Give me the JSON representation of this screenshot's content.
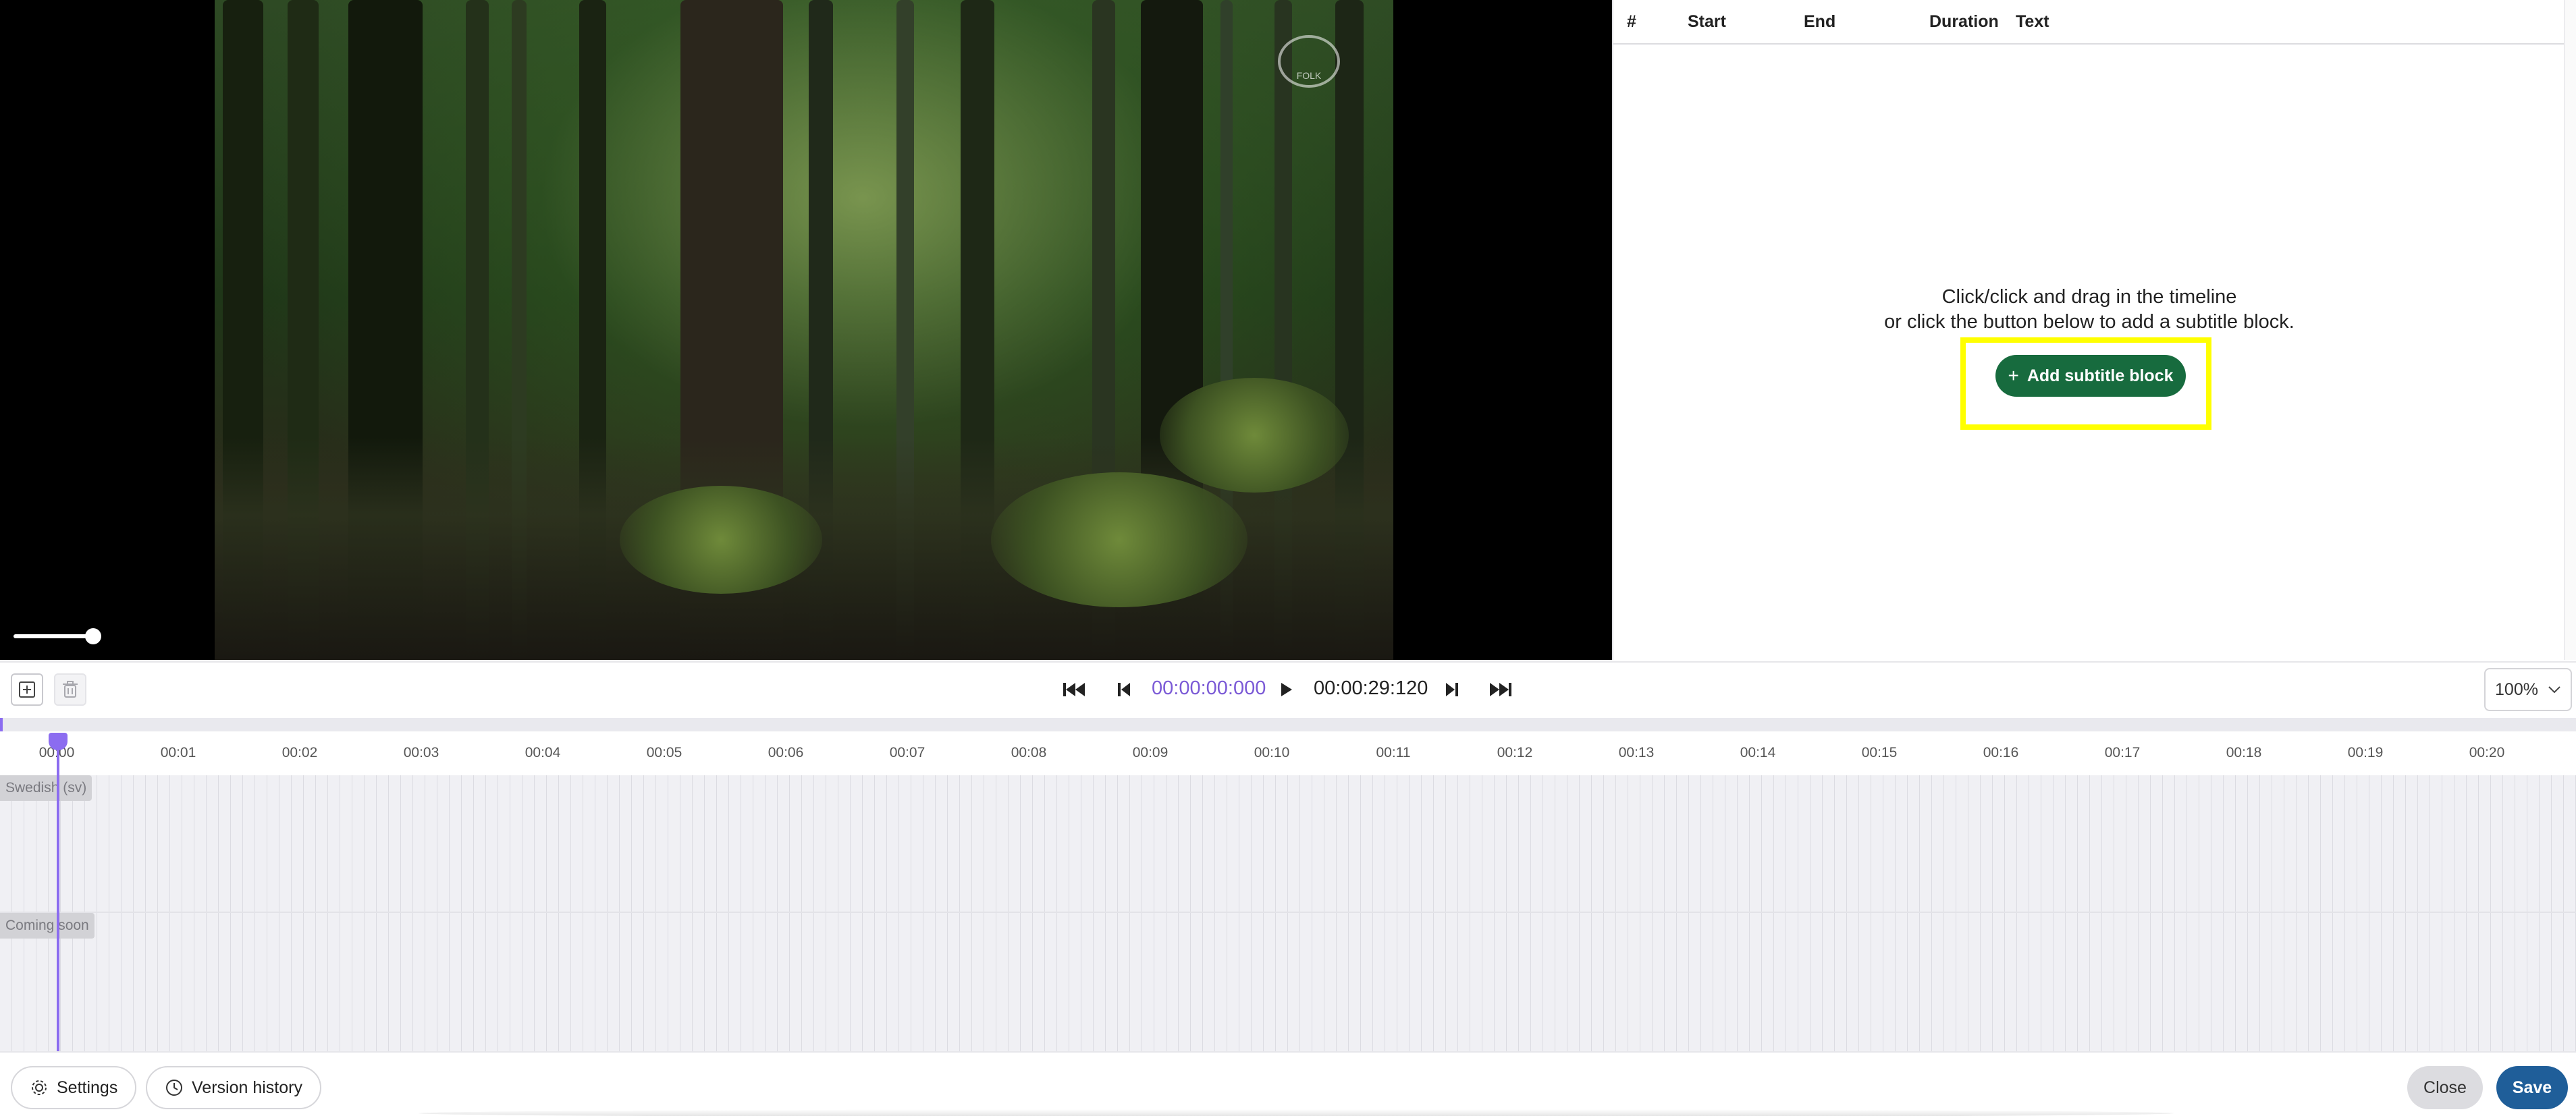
{
  "video": {
    "volume_level": 0.85
  },
  "subtitle_table": {
    "columns": [
      "#",
      "Start",
      "End",
      "Duration",
      "Text"
    ],
    "empty_state_line1": "Click/click and drag in the timeline",
    "empty_state_line2": "or click the button below to add a subtitle block.",
    "add_button_label": "Add subtitle block",
    "add_button_icon": "plus-icon"
  },
  "transport": {
    "current_time": "00:00:00:000",
    "total_time": "00:00:29:120",
    "zoom": "100%",
    "icons": [
      "skip-to-start-icon",
      "step-back-icon",
      "play-icon",
      "step-forward-icon",
      "skip-to-end-icon"
    ]
  },
  "timeline": {
    "ticks": [
      "00:00",
      "00:01",
      "00:02",
      "00:03",
      "00:04",
      "00:05",
      "00:06",
      "00:07",
      "00:08",
      "00:09",
      "00:10",
      "00:11",
      "00:12",
      "00:13",
      "00:14",
      "00:15",
      "00:16",
      "00:17",
      "00:18",
      "00:19",
      "00:20"
    ],
    "tracks": [
      "Swedish (sv)",
      "Coming soon"
    ]
  },
  "footer": {
    "settings_label": "Settings",
    "version_history_label": "Version history",
    "close_label": "Close",
    "save_label": "Save"
  },
  "colors": {
    "accent_purple": "#8b6cf0",
    "add_button_green": "#176b3e",
    "save_blue": "#1f5e99",
    "highlight_yellow": "#ffff00"
  }
}
